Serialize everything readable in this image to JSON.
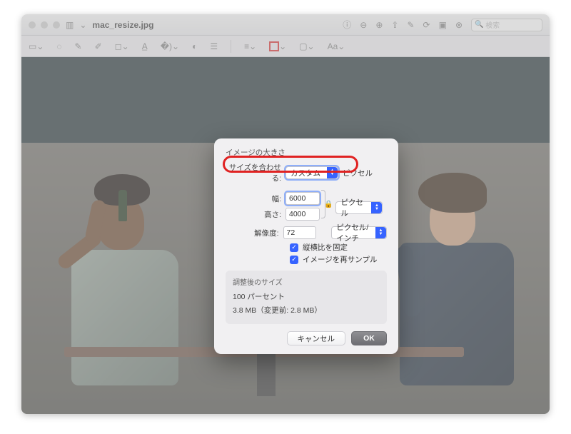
{
  "titlebar": {
    "filename": "mac_resize.jpg",
    "search_placeholder": "検索"
  },
  "dialog": {
    "section_label": "イメージの大きさ",
    "fit_label": "サイズを合わせる:",
    "fit_value": "カスタム",
    "fit_unit": "ピクセル",
    "width_label": "幅:",
    "width_value": "6000",
    "height_label": "高さ:",
    "height_value": "4000",
    "wh_unit": "ピクセル",
    "resolution_label": "解像度:",
    "resolution_value": "72",
    "resolution_unit": "ピクセル/インチ",
    "lock_aspect_label": "縦横比を固定",
    "resample_label": "イメージを再サンプル",
    "resulting_title": "調整後のサイズ",
    "resulting_percent": "100 パーセント",
    "resulting_size": "3.8 MB（変更前: 2.8 MB）",
    "cancel": "キャンセル",
    "ok": "OK"
  }
}
